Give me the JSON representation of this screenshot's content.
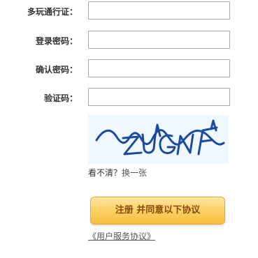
{
  "form": {
    "username": {
      "label": "多玩通行证：",
      "value": ""
    },
    "password": {
      "label": "登录密码：",
      "value": ""
    },
    "confirm_password": {
      "label": "确认密码：",
      "value": ""
    },
    "captcha": {
      "label": "验证码：",
      "value": ""
    }
  },
  "captcha_image": {
    "text": "ZUGNF",
    "background_color": "#f0f8ff",
    "ink_color": "#1e4a9c"
  },
  "refresh": {
    "prompt": "看不清？",
    "link": "换一张"
  },
  "register_button": {
    "label": "注册  并同意以下协议"
  },
  "agreement_link": {
    "label": "《用户服务协议》"
  },
  "colors": {
    "button_top": "#fee6a1",
    "button_bottom": "#f8bd3f",
    "button_text": "#8a4b06"
  }
}
